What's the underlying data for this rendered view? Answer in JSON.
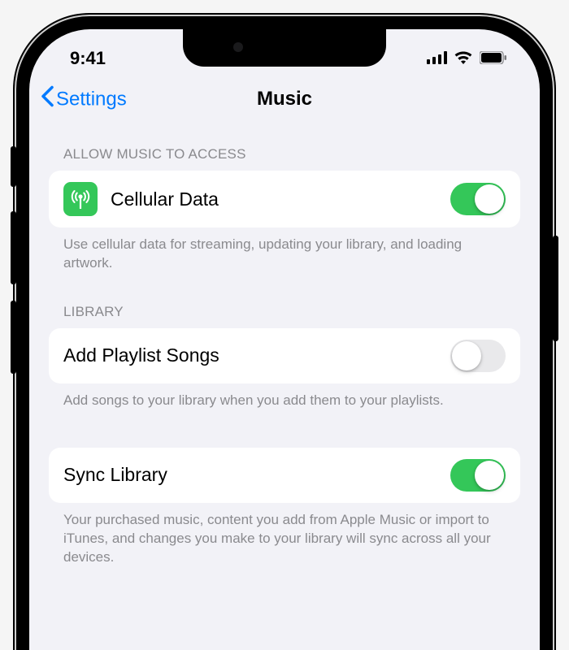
{
  "status": {
    "time": "9:41"
  },
  "nav": {
    "back": "Settings",
    "title": "Music"
  },
  "sections": {
    "access": {
      "header": "ALLOW MUSIC TO ACCESS",
      "cellular": {
        "label": "Cellular Data",
        "on": true
      },
      "footer": "Use cellular data for streaming, updating your library, and loading artwork."
    },
    "library": {
      "header": "LIBRARY",
      "addPlaylist": {
        "label": "Add Playlist Songs",
        "on": false
      },
      "addPlaylistFooter": "Add songs to your library when you add them to your playlists.",
      "syncLibrary": {
        "label": "Sync Library",
        "on": true
      },
      "syncLibraryFooter": "Your purchased music, content you add from Apple Music or import to iTunes, and changes you make to your library will sync across all your devices."
    }
  }
}
